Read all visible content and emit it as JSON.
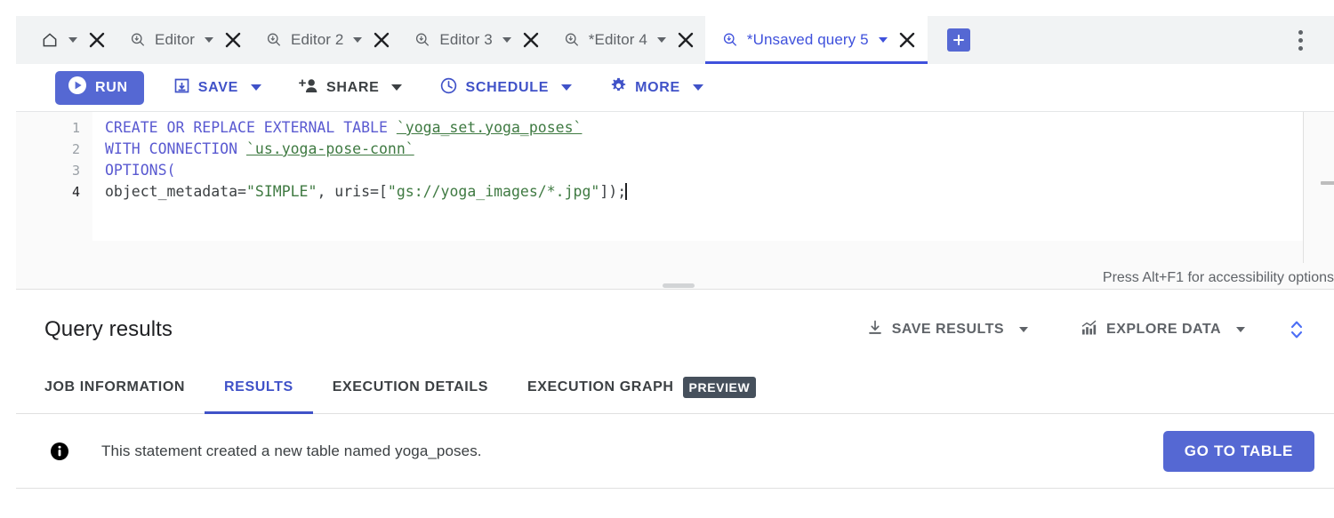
{
  "tabs": [
    {
      "id": "home",
      "label": "",
      "icon": "home-icon",
      "has_caret": true,
      "has_close": true,
      "active": false
    },
    {
      "id": "editor-1",
      "label": "Editor",
      "icon": "query-editor-icon",
      "has_caret": true,
      "has_close": true,
      "active": false
    },
    {
      "id": "editor-2",
      "label": "Editor 2",
      "icon": "query-editor-icon",
      "has_caret": true,
      "has_close": true,
      "active": false
    },
    {
      "id": "editor-3",
      "label": "Editor 3",
      "icon": "query-editor-icon",
      "has_caret": true,
      "has_close": true,
      "active": false
    },
    {
      "id": "editor-4",
      "label": "*Editor 4",
      "icon": "query-editor-icon",
      "has_caret": true,
      "has_close": true,
      "active": false
    },
    {
      "id": "unsaved-query-5",
      "label": "*Unsaved query 5",
      "icon": "query-editor-icon",
      "has_caret": true,
      "has_close": true,
      "active": true
    }
  ],
  "tabbar": {
    "add_tab_label": "+",
    "overflow_menu_label": "More options"
  },
  "toolbar": {
    "run_label": "RUN",
    "save_label": "SAVE",
    "share_label": "SHARE",
    "schedule_label": "SCHEDULE",
    "more_label": "MORE",
    "accent_blue": "#5568d3",
    "link_blue": "#4052c8"
  },
  "editor": {
    "lines": [
      {
        "number": "1",
        "active": false,
        "tokens": [
          {
            "text": "CREATE OR REPLACE EXTERNAL TABLE ",
            "type": "kw"
          },
          {
            "text": "`yoga_set.yoga_poses`",
            "type": "id"
          }
        ]
      },
      {
        "number": "2",
        "active": false,
        "tokens": [
          {
            "text": "WITH CONNECTION ",
            "type": "kw"
          },
          {
            "text": "`us.yoga-pose-conn`",
            "type": "id"
          }
        ]
      },
      {
        "number": "3",
        "active": false,
        "tokens": [
          {
            "text": "OPTIONS(",
            "type": "kw"
          }
        ]
      },
      {
        "number": "4",
        "active": true,
        "tokens": [
          {
            "text": "object_metadata=",
            "type": "pl"
          },
          {
            "text": "\"SIMPLE\"",
            "type": "str"
          },
          {
            "text": ", uris=[",
            "type": "pl"
          },
          {
            "text": "\"gs://yoga_images/*.jpg\"",
            "type": "str"
          },
          {
            "text": "]);",
            "type": "pl"
          }
        ]
      }
    ],
    "accessibility_hint": "Press Alt+F1 for accessibility options"
  },
  "results": {
    "title": "Query results",
    "save_results_label": "SAVE RESULTS",
    "explore_data_label": "EXPLORE DATA",
    "expand_label": "Expand results pane",
    "tabs": [
      {
        "id": "job-information",
        "label": "JOB INFORMATION",
        "active": false,
        "badge": null
      },
      {
        "id": "results",
        "label": "RESULTS",
        "active": true,
        "badge": null
      },
      {
        "id": "execution-details",
        "label": "EXECUTION DETAILS",
        "active": false,
        "badge": null
      },
      {
        "id": "execution-graph",
        "label": "EXECUTION GRAPH",
        "active": false,
        "badge": "PREVIEW"
      }
    ],
    "message": "This statement created a new table named yoga_poses.",
    "primary_action_label": "GO TO TABLE"
  },
  "colors": {
    "accent": "#5568d3",
    "active_tab_text": "#3f51dc",
    "keyword": "#5a5ad1",
    "string": "#3f7a42",
    "badge_bg": "#46505c",
    "tabbar_bg": "#f1f3f4",
    "editor_bg": "#fafafa"
  }
}
